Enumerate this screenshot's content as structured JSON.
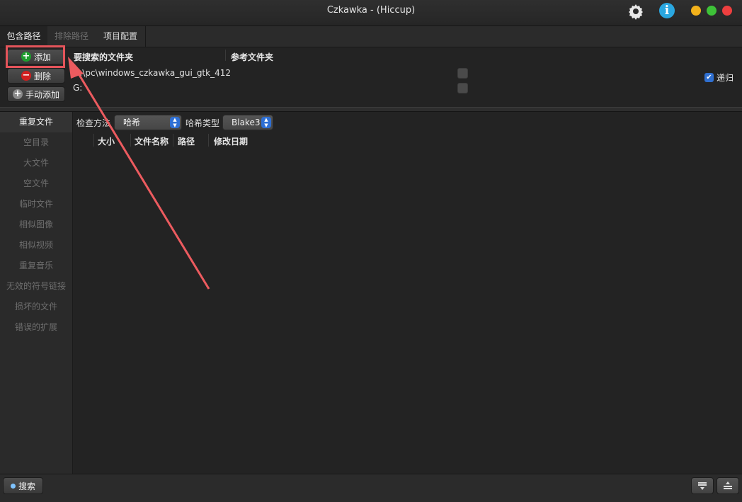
{
  "window": {
    "title": "Czkawka - (Hiccup)"
  },
  "top_icons": [
    "gear-icon",
    "info-icon"
  ],
  "colors": {
    "highlight": "#e4545a",
    "accent": "#2f6fd0",
    "add_green": "#1f9e2f",
    "remove_red": "#d21f1f"
  },
  "tabs": [
    {
      "label": "包含路径"
    },
    {
      "label": "排除路径"
    },
    {
      "label": "项目配置"
    }
  ],
  "folder_buttons": {
    "add": "添加",
    "remove": "删除",
    "manual_add": "手动添加"
  },
  "folders_table": {
    "col_search": "要搜索的文件夹",
    "col_reference": "参考文件夹",
    "rows": [
      {
        "path": "D:\\pc\\windows_czkawka_gui_gtk_412"
      },
      {
        "path": "G:"
      }
    ],
    "recursive_label": "递归",
    "recursive_checked": true
  },
  "sidebar": {
    "items": [
      "重复文件",
      "空目录",
      "大文件",
      "空文件",
      "临时文件",
      "相似图像",
      "相似视频",
      "重复音乐",
      "无效的符号链接",
      "损坏的文件",
      "错误的扩展"
    ],
    "active": "重复文件"
  },
  "options": {
    "check_method_label": "检查方法",
    "check_method_value": "哈希",
    "hash_type_label": "哈希类型",
    "hash_type_value": "Blake3"
  },
  "results_columns": [
    "大小",
    "文件名称",
    "路径",
    "修改日期"
  ],
  "bottom": {
    "search_label": "搜索"
  }
}
